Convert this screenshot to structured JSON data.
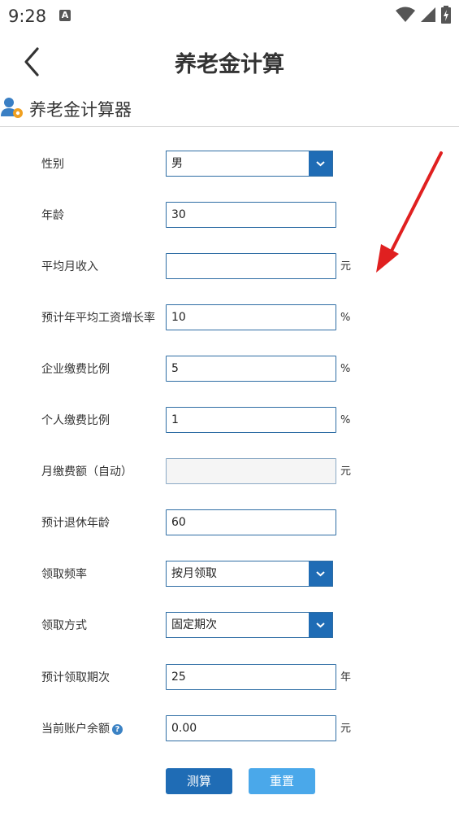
{
  "status_bar": {
    "time": "9:28",
    "notification_letter": "A"
  },
  "header": {
    "title": "养老金计算"
  },
  "section": {
    "title": "养老金计算器"
  },
  "form": {
    "gender": {
      "label": "性别",
      "value": "男"
    },
    "age": {
      "label": "年龄",
      "value": "30"
    },
    "avg_monthly_income": {
      "label": "平均月收入",
      "value": "",
      "unit": "元"
    },
    "salary_growth_rate": {
      "label": "预计年平均工资增长率",
      "value": "10",
      "unit": "%"
    },
    "company_rate": {
      "label": "企业缴费比例",
      "value": "5",
      "unit": "%"
    },
    "personal_rate": {
      "label": "个人缴费比例",
      "value": "1",
      "unit": "%"
    },
    "monthly_payment": {
      "label": "月缴费额（自动）",
      "value": "",
      "unit": "元"
    },
    "retire_age": {
      "label": "预计退休年龄",
      "value": "60"
    },
    "claim_frequency": {
      "label": "领取频率",
      "value": "按月领取"
    },
    "claim_method": {
      "label": "领取方式",
      "value": "固定期次"
    },
    "claim_periods": {
      "label": "预计领取期次",
      "value": "25",
      "unit": "年"
    },
    "balance": {
      "label": "当前账户余额",
      "value": "0.00",
      "unit": "元"
    }
  },
  "buttons": {
    "calculate": "测算",
    "reset": "重置"
  },
  "icons": {
    "back": "chevron-left-icon",
    "help": "help-icon",
    "dropdown": "chevron-down-icon",
    "section": "user-gear-icon"
  },
  "colors": {
    "primary": "#1f6cb5",
    "secondary": "#4aa8ea",
    "annotation_arrow": "#e02020"
  }
}
